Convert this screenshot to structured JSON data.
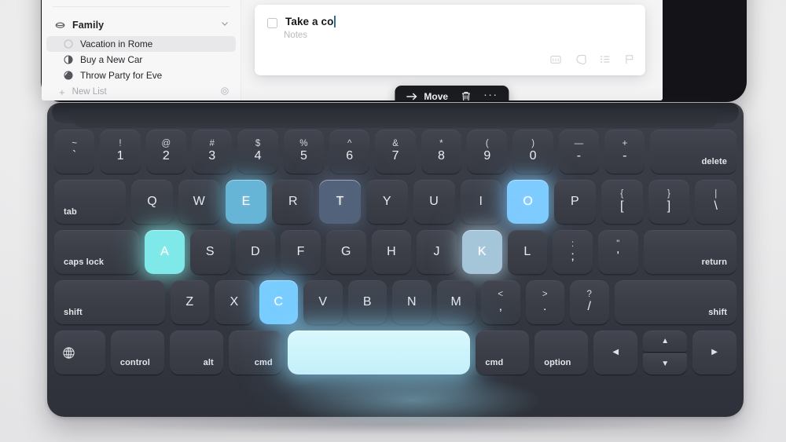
{
  "app": {
    "sidebar": {
      "group": {
        "label": "Family",
        "icon": "cloud-icon",
        "chevron": "chevron-down-icon"
      },
      "items": [
        {
          "label": "Vacation in Rome",
          "progress": "empty",
          "selected": true
        },
        {
          "label": "Buy a New Car",
          "progress": "half",
          "selected": false
        },
        {
          "label": "Throw Party for Eve",
          "progress": "three-quarter",
          "selected": false
        }
      ],
      "new_list": {
        "label": "New List",
        "plus": "+",
        "settings_icon": "gear-icon"
      }
    },
    "note": {
      "title": "Take a co",
      "placeholder": "Notes",
      "checkbox_state": "unchecked",
      "toolbar_icons": [
        "calendar-icon",
        "tag-icon",
        "list-icon",
        "flag-icon"
      ]
    },
    "action_bar": {
      "move_label": "Move",
      "move_icon": "arrow-right-icon",
      "delete_icon": "trash-icon",
      "more_icon": "ellipsis-icon"
    }
  },
  "keyboard": {
    "rows": [
      {
        "name": "number-row",
        "keys": [
          {
            "id": "backtick",
            "top": "~",
            "bottom": "`",
            "type": "dual"
          },
          {
            "id": "1",
            "top": "!",
            "bottom": "1",
            "type": "dual"
          },
          {
            "id": "2",
            "top": "@",
            "bottom": "2",
            "type": "dual"
          },
          {
            "id": "3",
            "top": "#",
            "bottom": "3",
            "type": "dual"
          },
          {
            "id": "4",
            "top": "$",
            "bottom": "4",
            "type": "dual"
          },
          {
            "id": "5",
            "top": "%",
            "bottom": "5",
            "type": "dual"
          },
          {
            "id": "6",
            "top": "^",
            "bottom": "6",
            "type": "dual"
          },
          {
            "id": "7",
            "top": "&",
            "bottom": "7",
            "type": "dual"
          },
          {
            "id": "8",
            "top": "*",
            "bottom": "8",
            "type": "dual"
          },
          {
            "id": "9",
            "top": "(",
            "bottom": "9",
            "type": "dual"
          },
          {
            "id": "0",
            "top": ")",
            "bottom": "0",
            "type": "dual"
          },
          {
            "id": "minus",
            "top": "—",
            "bottom": "-",
            "type": "dual"
          },
          {
            "id": "equal",
            "top": "+",
            "bottom": "-",
            "type": "dual"
          },
          {
            "id": "delete",
            "label": "delete",
            "type": "word",
            "align": "right",
            "flex": 1.9
          }
        ]
      },
      {
        "name": "qwerty-row",
        "keys": [
          {
            "id": "tab",
            "label": "tab",
            "type": "word",
            "flex": 1.5
          },
          {
            "id": "Q",
            "label": "Q",
            "type": "letter"
          },
          {
            "id": "W",
            "label": "W",
            "type": "letter"
          },
          {
            "id": "E",
            "label": "E",
            "type": "letter",
            "lit": "#66b4d6"
          },
          {
            "id": "R",
            "label": "R",
            "type": "letter"
          },
          {
            "id": "T",
            "label": "T",
            "type": "letter",
            "lit": "#51627a"
          },
          {
            "id": "Y",
            "label": "Y",
            "type": "letter"
          },
          {
            "id": "U",
            "label": "U",
            "type": "letter"
          },
          {
            "id": "I",
            "label": "I",
            "type": "letter"
          },
          {
            "id": "O",
            "label": "O",
            "type": "letter",
            "lit": "#7ecbff"
          },
          {
            "id": "P",
            "label": "P",
            "type": "letter"
          },
          {
            "id": "bracket-left",
            "top": "{",
            "bottom": "[",
            "type": "dual"
          },
          {
            "id": "bracket-right",
            "top": "}",
            "bottom": "]",
            "type": "dual"
          },
          {
            "id": "backslash",
            "top": "|",
            "bottom": "\\",
            "type": "dual"
          }
        ]
      },
      {
        "name": "home-row",
        "keys": [
          {
            "id": "caps-lock",
            "label": "caps lock",
            "type": "word",
            "flex": 1.9
          },
          {
            "id": "A",
            "label": "A",
            "type": "letter",
            "lit": "#7ee9e8"
          },
          {
            "id": "S",
            "label": "S",
            "type": "letter"
          },
          {
            "id": "D",
            "label": "D",
            "type": "letter"
          },
          {
            "id": "F",
            "label": "F",
            "type": "letter"
          },
          {
            "id": "G",
            "label": "G",
            "type": "letter"
          },
          {
            "id": "H",
            "label": "H",
            "type": "letter"
          },
          {
            "id": "J",
            "label": "J",
            "type": "letter"
          },
          {
            "id": "K",
            "label": "K",
            "type": "letter",
            "lit": "#a5c5d9"
          },
          {
            "id": "L",
            "label": "L",
            "type": "letter"
          },
          {
            "id": "semicolon",
            "top": ":",
            "bottom": ";",
            "type": "dual"
          },
          {
            "id": "quote",
            "top": "\"",
            "bottom": "'",
            "type": "dual"
          },
          {
            "id": "return",
            "label": "return",
            "type": "word",
            "align": "right",
            "flex": 2.1
          }
        ]
      },
      {
        "name": "shift-row",
        "keys": [
          {
            "id": "shift-left",
            "label": "shift",
            "type": "word",
            "flex": 2.6
          },
          {
            "id": "Z",
            "label": "Z",
            "type": "letter"
          },
          {
            "id": "X",
            "label": "X",
            "type": "letter"
          },
          {
            "id": "C",
            "label": "C",
            "type": "letter",
            "lit": "#79cdff"
          },
          {
            "id": "V",
            "label": "V",
            "type": "letter"
          },
          {
            "id": "B",
            "label": "B",
            "type": "letter"
          },
          {
            "id": "N",
            "label": "N",
            "type": "letter"
          },
          {
            "id": "M",
            "label": "M",
            "type": "letter"
          },
          {
            "id": "comma",
            "top": "<",
            "bottom": ",",
            "type": "dual"
          },
          {
            "id": "period",
            "top": ">",
            "bottom": ".",
            "type": "dual"
          },
          {
            "id": "slash",
            "top": "?",
            "bottom": "/",
            "type": "dual"
          },
          {
            "id": "shift-right",
            "label": "shift",
            "type": "word",
            "align": "right",
            "flex": 2.9
          }
        ]
      },
      {
        "name": "bottom-row",
        "keys": [
          {
            "id": "globe",
            "label": "",
            "type": "icon",
            "icon": "globe-icon",
            "flex": 1.45
          },
          {
            "id": "control",
            "label": "control",
            "type": "word",
            "flex": 1.25
          },
          {
            "id": "alt",
            "label": "alt",
            "type": "word",
            "align": "right",
            "flex": 1.25
          },
          {
            "id": "cmd-left",
            "label": "cmd",
            "type": "word",
            "align": "right",
            "flex": 1.25
          },
          {
            "id": "space",
            "label": "",
            "type": "space",
            "lit": "#cdf4fb",
            "flex": 5.2
          },
          {
            "id": "cmd-right",
            "label": "cmd",
            "type": "word",
            "flex": 1.25
          },
          {
            "id": "option",
            "label": "option",
            "type": "word",
            "flex": 1.25
          },
          {
            "id": "arrow-left",
            "label": "◀",
            "type": "arrow",
            "flex": 1.25
          },
          {
            "id": "arrow-updown",
            "up": "▲",
            "down": "▼",
            "type": "arrowstack",
            "flex": 1.25
          },
          {
            "id": "arrow-right",
            "label": "▶",
            "type": "arrow",
            "flex": 1.25
          }
        ]
      }
    ]
  },
  "colors": {
    "key_base": "#3b3e47",
    "keyboard_body": "#373a43",
    "bezel": "#141418",
    "backdrop": "#ececed",
    "glow_cyan": "#cdf4fb"
  }
}
